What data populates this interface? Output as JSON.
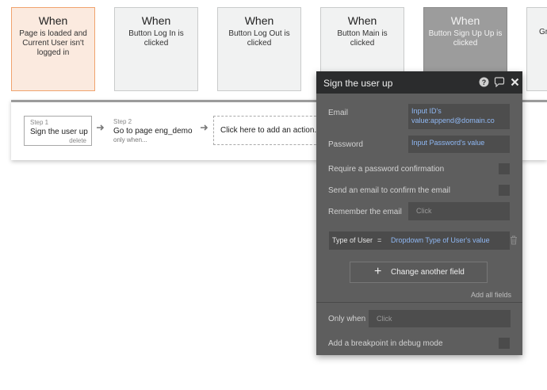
{
  "events": [
    {
      "when": "When",
      "desc": "Page is loaded and Current User isn't logged in"
    },
    {
      "when": "When",
      "desc": "Button Log In is clicked"
    },
    {
      "when": "When",
      "desc": "Button Log Out is clicked"
    },
    {
      "when": "When",
      "desc": "Button Main is clicked"
    },
    {
      "when": "When",
      "desc": "Button Sign Up Up is clicked"
    },
    {
      "when": "",
      "desc": "Gr"
    }
  ],
  "workflow": {
    "step1": {
      "num": "Step 1",
      "title": "Sign the user up",
      "delete": "delete"
    },
    "step2": {
      "num": "Step 2",
      "title": "Go to page eng_demo",
      "sub": "only when..."
    },
    "add_action": "Click here to add an action..."
  },
  "panel": {
    "title": "Sign the user up",
    "icons": [
      "help-icon",
      "comment-icon",
      "close-icon"
    ],
    "email_label": "Email",
    "email_value": "Input ID's value:append@domain.co",
    "password_label": "Password",
    "password_value": "Input Password's value",
    "require_confirm": "Require a password confirmation",
    "send_email": "Send an email to confirm the email",
    "remember_label": "Remember the email",
    "remember_value": "Click",
    "field_key": "Type of User",
    "field_eq": "=",
    "field_value": "Dropdown Type of User's value",
    "change_field": "Change another field",
    "add_all": "Add all fields",
    "only_when_label": "Only when",
    "only_when_value": "Click",
    "breakpoint": "Add a breakpoint in debug mode"
  }
}
